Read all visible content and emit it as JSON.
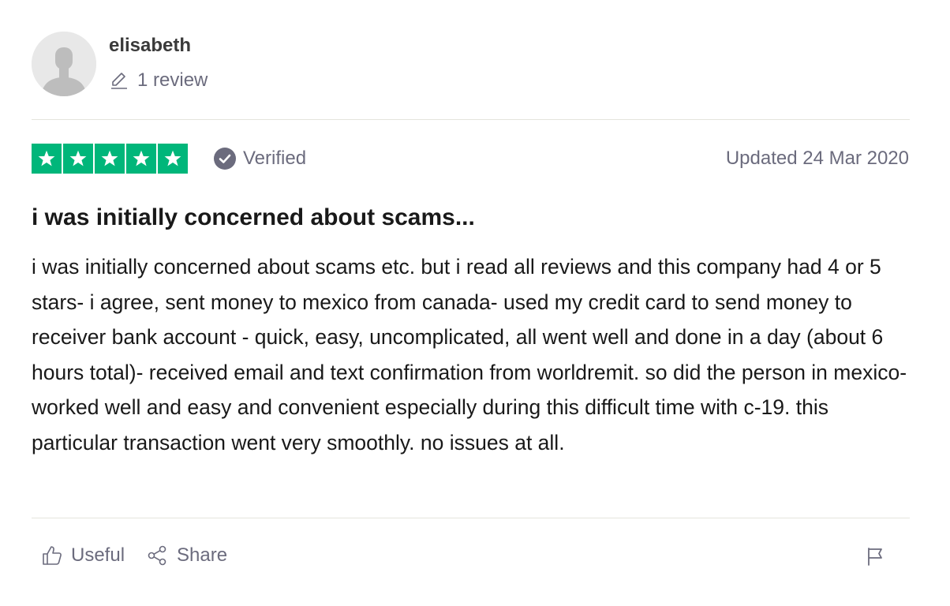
{
  "consumer": {
    "name": "elisabeth",
    "review_count_label": "1 review",
    "avatar_icon": "default-user-icon",
    "pencil_icon": "pencil-icon"
  },
  "review": {
    "rating_stars": 5,
    "rating_max": 5,
    "star_color": "#00b67a",
    "verified_label": "Verified",
    "verified_icon": "check-circle-icon",
    "date_label": "Updated 24 Mar 2020",
    "title": "i was initially concerned about scams...",
    "body": "i was initially concerned about scams etc. but i read all reviews and this company had 4 or 5 stars- i agree, sent money to mexico from canada- used my credit card to send money to receiver bank account - quick, easy, uncomplicated, all went well and done in a day (about 6 hours total)- received email and text confirmation from worldremit. so did the person in mexico- worked well and easy and convenient especially during this difficult time with c-19. this particular transaction went very smoothly. no issues at all."
  },
  "actions": {
    "useful_label": "Useful",
    "useful_icon": "thumbs-up-icon",
    "share_label": "Share",
    "share_icon": "share-icon",
    "flag_icon": "flag-icon"
  },
  "colors": {
    "text_muted": "#6b6b7d",
    "text_main": "#191919",
    "divider": "#e5e5dd"
  }
}
